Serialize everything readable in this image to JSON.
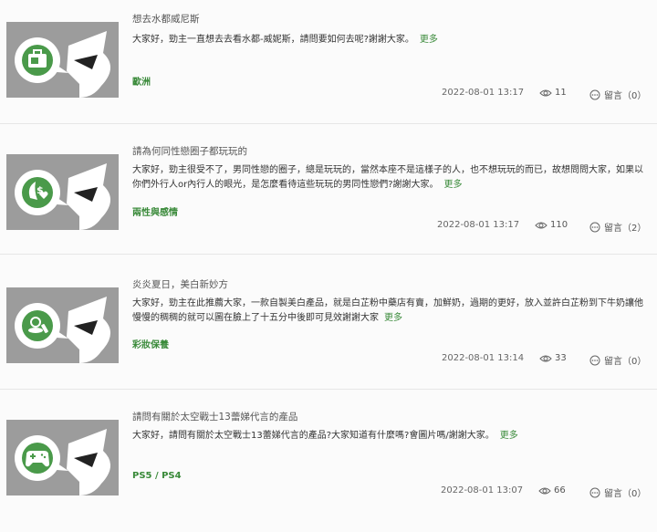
{
  "posts": [
    {
      "title": "想去水都威尼斯",
      "desc": "大家好，勁主一直想去去看水都-威妮斯，請問要如何去呢?謝謝大家。",
      "more": "更多",
      "category": "歐洲",
      "datetime": "2022-08-01 13:17",
      "views": "11",
      "comments": "留言（0）",
      "icon": "suitcase-icon"
    },
    {
      "title": "請為何同性戀圈子都玩玩的",
      "desc": "大家好，勁主很受不了，男同性戀的圈子，總是玩玩的，當然本座不是這樣子的人，也不想玩玩的而已，故想問問大家，如果以你們外行人or內行人的眼光，是怎麼看待這些玩玩的男同性戀們?謝謝大家。",
      "more": "更多",
      "category": "兩性與感情",
      "datetime": "2022-08-01 13:17",
      "views": "110",
      "comments": "留言（2）",
      "icon": "money-heart-icon"
    },
    {
      "title": "炎炎夏日，美白新妙方",
      "desc": "大家好，勁主在此推薦大家，一款自製美白產品，就是白芷粉中藥店有賣，加鮮奶，過期的更好，放入並許白芷粉到下牛奶讓他慢慢的稠稠的就可以圖在臉上了十五分中後即可見效謝謝大家",
      "more": "更多",
      "category": "彩妝保養",
      "datetime": "2022-08-01 13:14",
      "views": "33",
      "comments": "留言（0）",
      "icon": "cosmetics-icon"
    },
    {
      "title": "請問有關於太空戰士13蕾娣代言的產品",
      "desc": "大家好，請問有關於太空戰士13蕾娣代言的產品?大家知道有什麼嗎?會圖片嗎/謝謝大家。",
      "more": "更多",
      "category": "PS5 / PS4",
      "datetime": "2022-08-01 13:07",
      "views": "66",
      "comments": "留言（0）",
      "icon": "gamepad-icon"
    }
  ],
  "colors": {
    "accent": "#3a8a3a",
    "thumb_bg": "#9c9c9c",
    "separator": "#e6e6e6"
  }
}
